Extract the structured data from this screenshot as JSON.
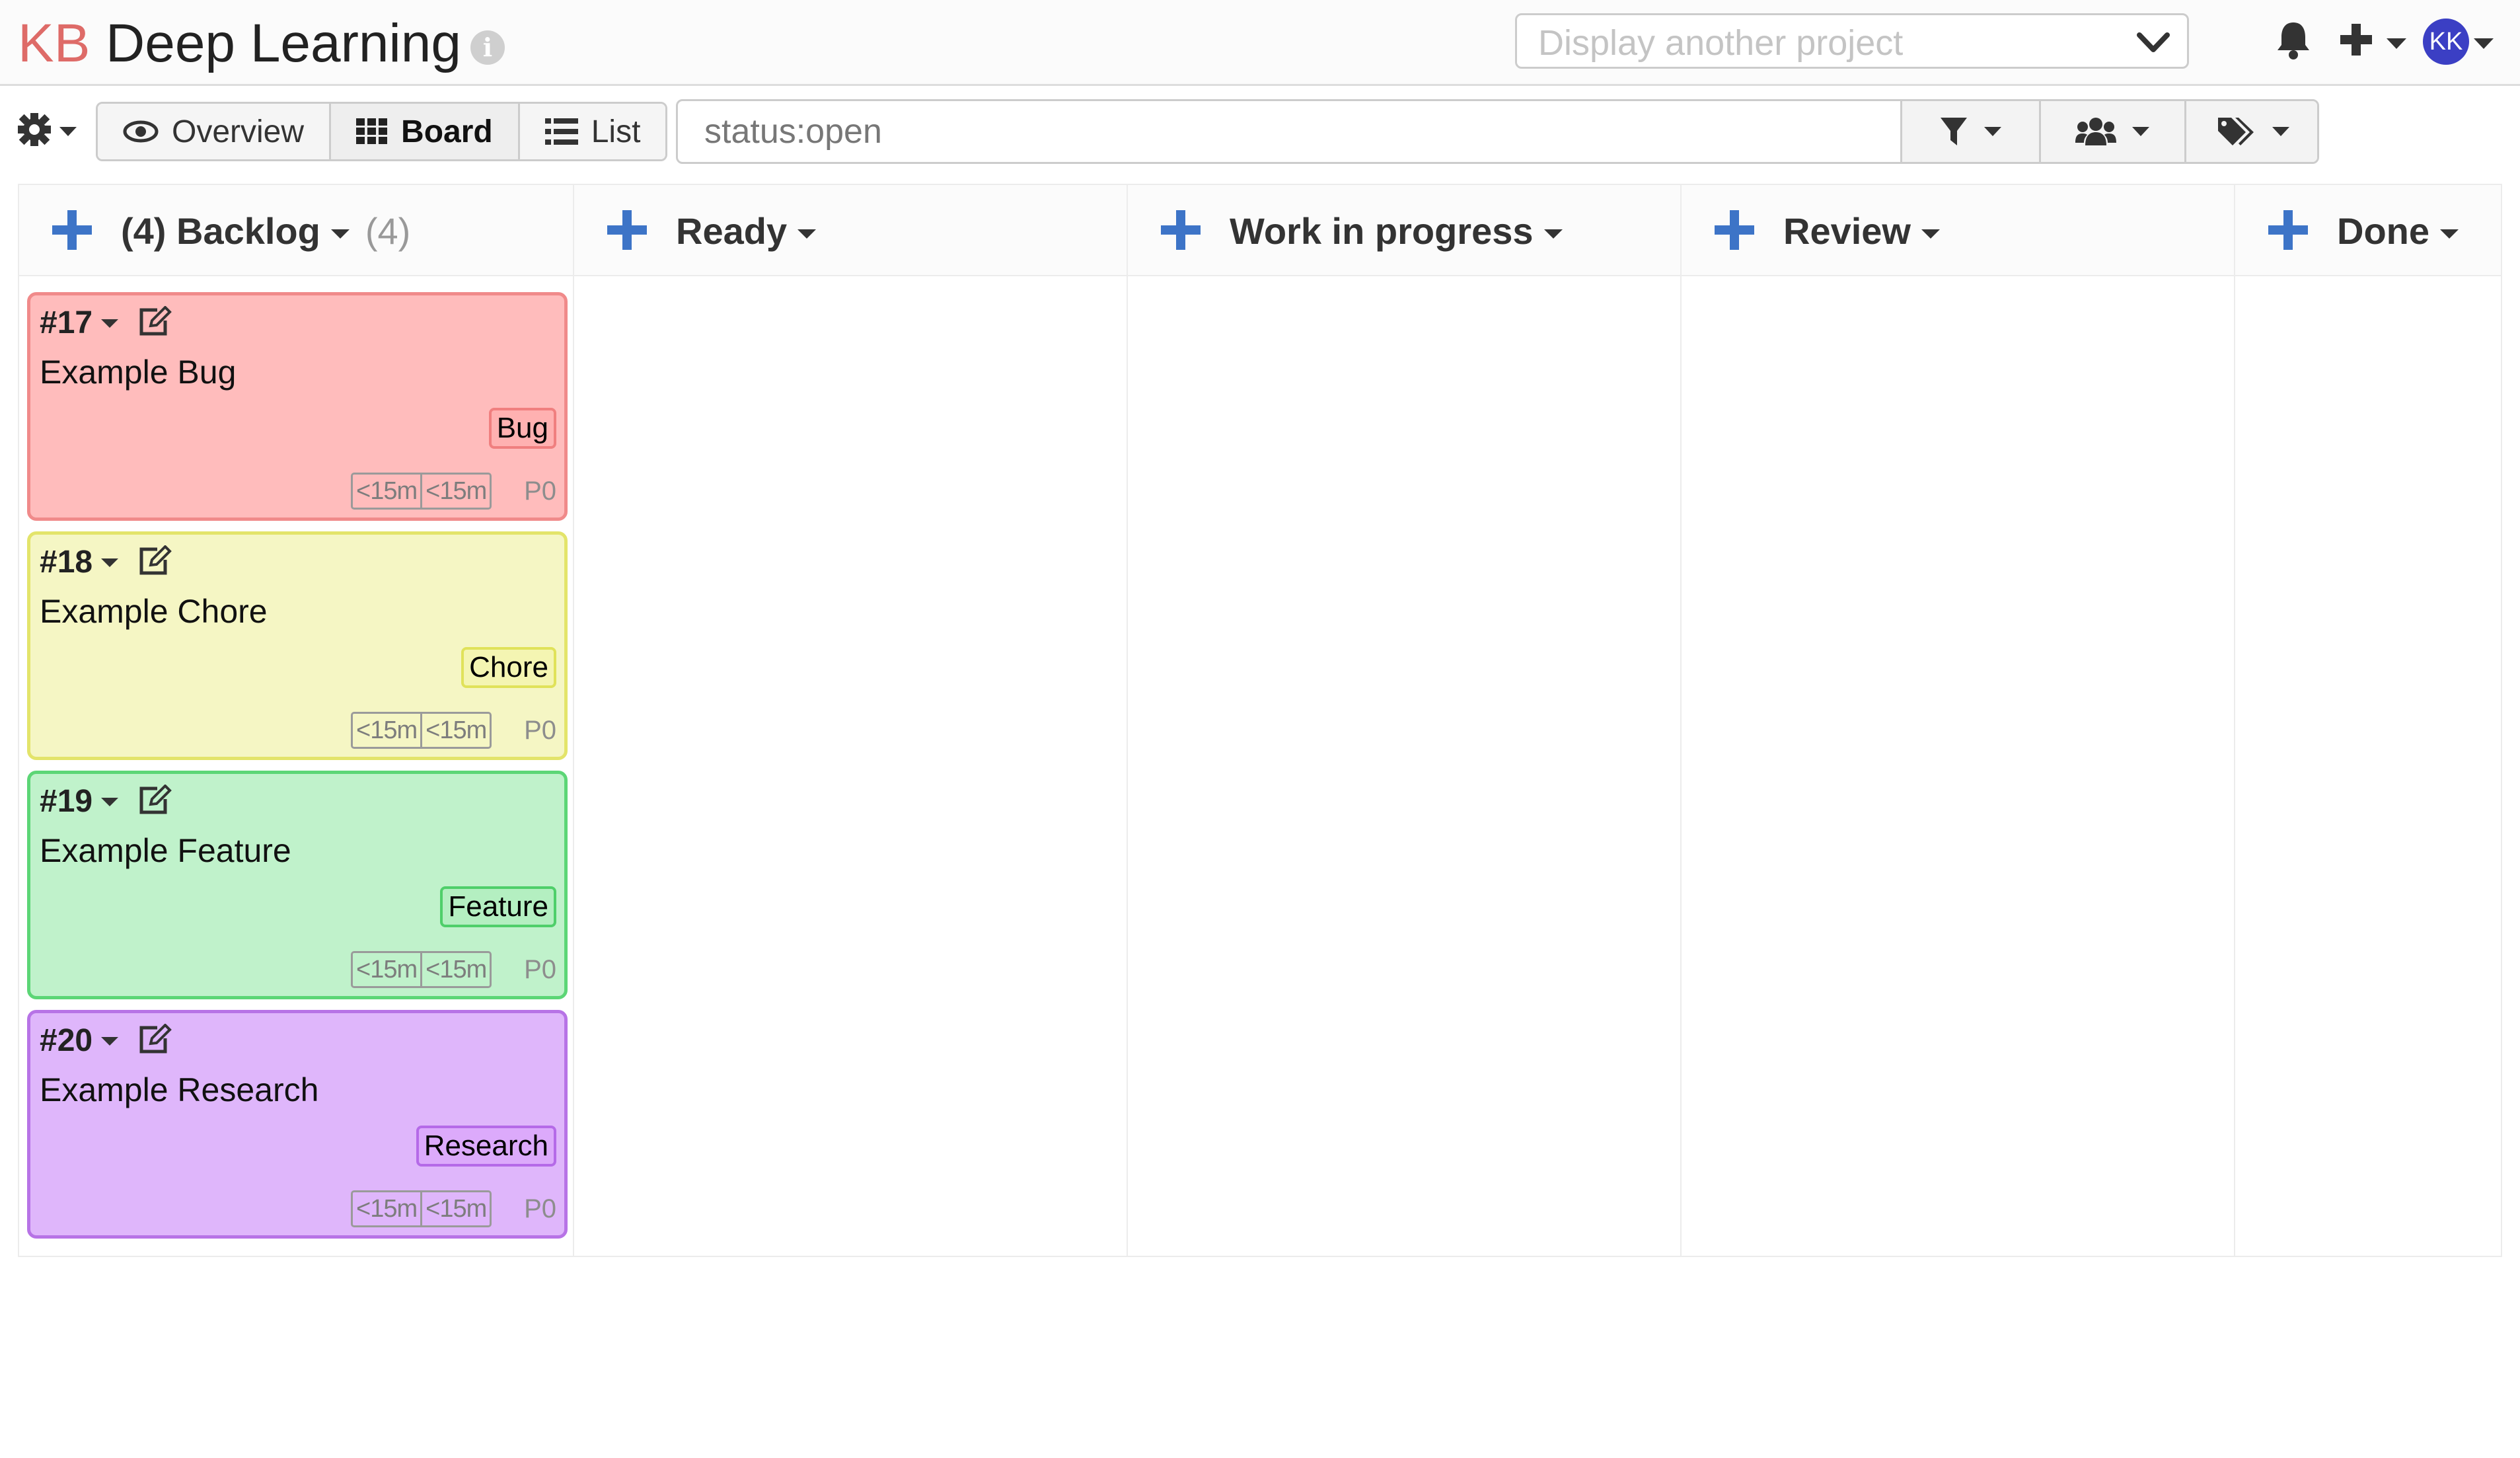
{
  "header": {
    "logo": "KB",
    "project_title": "Deep Learning",
    "info_icon": "info-icon",
    "project_select_placeholder": "Display another project",
    "user_initials": "KK"
  },
  "toolbar": {
    "views": [
      {
        "label": "Overview",
        "icon": "eye-icon",
        "active": false
      },
      {
        "label": "Board",
        "icon": "grid-icon",
        "active": true
      },
      {
        "label": "List",
        "icon": "list-icon",
        "active": false
      }
    ],
    "search_value": "status:open",
    "filters": [
      "filter-icon",
      "users-icon",
      "tags-icon"
    ]
  },
  "columns": [
    {
      "title": "(4) Backlog",
      "count": "(4)"
    },
    {
      "title": "Ready",
      "count": ""
    },
    {
      "title": "Work in progress",
      "count": ""
    },
    {
      "title": "Review",
      "count": ""
    },
    {
      "title": "Done",
      "count": ""
    }
  ],
  "cards": [
    {
      "id": "#17",
      "title": "Example Bug",
      "tag": "Bug",
      "time_estimated": "<15m",
      "time_spent": "<15m",
      "priority": "P0",
      "bg": "#ffbcbc",
      "border": "#f08a8a",
      "tag_bg": "#ffb1b1",
      "tag_border": "#f07f7f"
    },
    {
      "id": "#18",
      "title": "Example Chore",
      "tag": "Chore",
      "time_estimated": "<15m",
      "time_spent": "<15m",
      "priority": "P0",
      "bg": "#f5f6c4",
      "border": "#e3e46a",
      "tag_bg": "#f4f5b2",
      "tag_border": "#e0e25a"
    },
    {
      "id": "#19",
      "title": "Example Feature",
      "tag": "Feature",
      "time_estimated": "<15m",
      "time_spent": "<15m",
      "priority": "P0",
      "bg": "#c0f2cb",
      "border": "#5cd676",
      "tag_bg": "#b4efc1",
      "tag_border": "#4fcf6a"
    },
    {
      "id": "#20",
      "title": "Example Research",
      "tag": "Research",
      "time_estimated": "<15m",
      "time_spent": "<15m",
      "priority": "P0",
      "bg": "#dfb6fb",
      "border": "#b773e6",
      "tag_bg": "#dcaafb",
      "tag_border": "#b56ae8"
    }
  ]
}
